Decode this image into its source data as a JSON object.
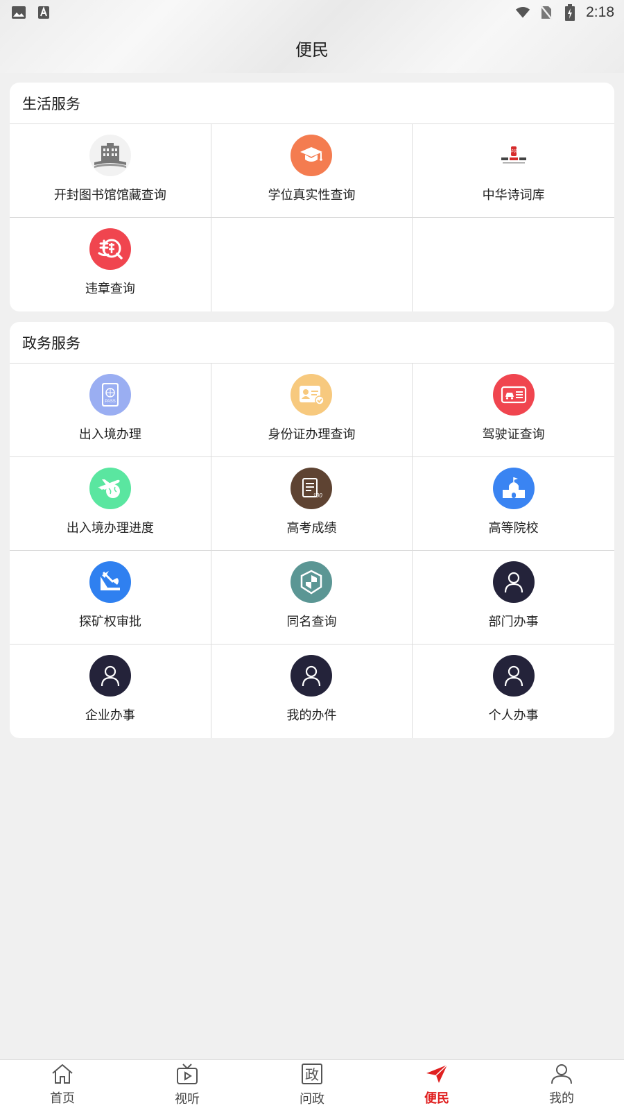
{
  "status_bar": {
    "time": "2:18",
    "left_icons": [
      "image-icon",
      "text-a-icon"
    ],
    "right_icons": [
      "wifi-icon",
      "no-sim-icon",
      "battery-charging-icon"
    ]
  },
  "header": {
    "title": "便民"
  },
  "sections": [
    {
      "title": "生活服务",
      "items": [
        {
          "label": "开封图书馆馆藏查询",
          "icon": "library-icon",
          "color": "#f2f2f2"
        },
        {
          "label": "学位真实性查询",
          "icon": "graduation-cap-icon",
          "color": "#f47c50"
        },
        {
          "label": "中华诗词库",
          "icon": "poetry-logo-icon",
          "color": "#ffffff",
          "logo_text": "中华诗词"
        },
        {
          "label": "违章查询",
          "icon": "violation-search-icon",
          "color": "#f0454f"
        },
        {
          "label": "",
          "icon": "",
          "color": ""
        },
        {
          "label": "",
          "icon": "",
          "color": ""
        }
      ]
    },
    {
      "title": "政务服务",
      "items": [
        {
          "label": "出入境办理",
          "icon": "passport-icon",
          "color": "#9aaef2",
          "icon_text": "PASS"
        },
        {
          "label": "身份证办理查询",
          "icon": "id-card-icon",
          "color": "#f7c97e"
        },
        {
          "label": "驾驶证查询",
          "icon": "driver-license-icon",
          "color": "#f0454f"
        },
        {
          "label": "出入境办理进度",
          "icon": "airplane-icon",
          "color": "#5ae6a0"
        },
        {
          "label": "高考成绩",
          "icon": "exam-score-icon",
          "color": "#5e4332",
          "icon_text": "100"
        },
        {
          "label": "高等院校",
          "icon": "school-icon",
          "color": "#3a84f2"
        },
        {
          "label": "探矿权审批",
          "icon": "mining-icon",
          "color": "#2f80f0"
        },
        {
          "label": "同名查询",
          "icon": "shield-icon",
          "color": "#5b9694"
        },
        {
          "label": "部门办事",
          "icon": "person-icon",
          "color": "#24233a"
        },
        {
          "label": "企业办事",
          "icon": "person-icon",
          "color": "#24233a"
        },
        {
          "label": "我的办件",
          "icon": "person-icon",
          "color": "#24233a"
        },
        {
          "label": "个人办事",
          "icon": "person-icon",
          "color": "#24233a"
        }
      ]
    }
  ],
  "bottom_nav": {
    "items": [
      {
        "label": "首页",
        "icon": "home-icon"
      },
      {
        "label": "视听",
        "icon": "tv-icon"
      },
      {
        "label": "问政",
        "icon": "politics-icon",
        "icon_text": "政"
      },
      {
        "label": "便民",
        "icon": "paper-plane-icon",
        "active": true
      },
      {
        "label": "我的",
        "icon": "user-icon"
      }
    ],
    "active_color": "#e02020"
  }
}
